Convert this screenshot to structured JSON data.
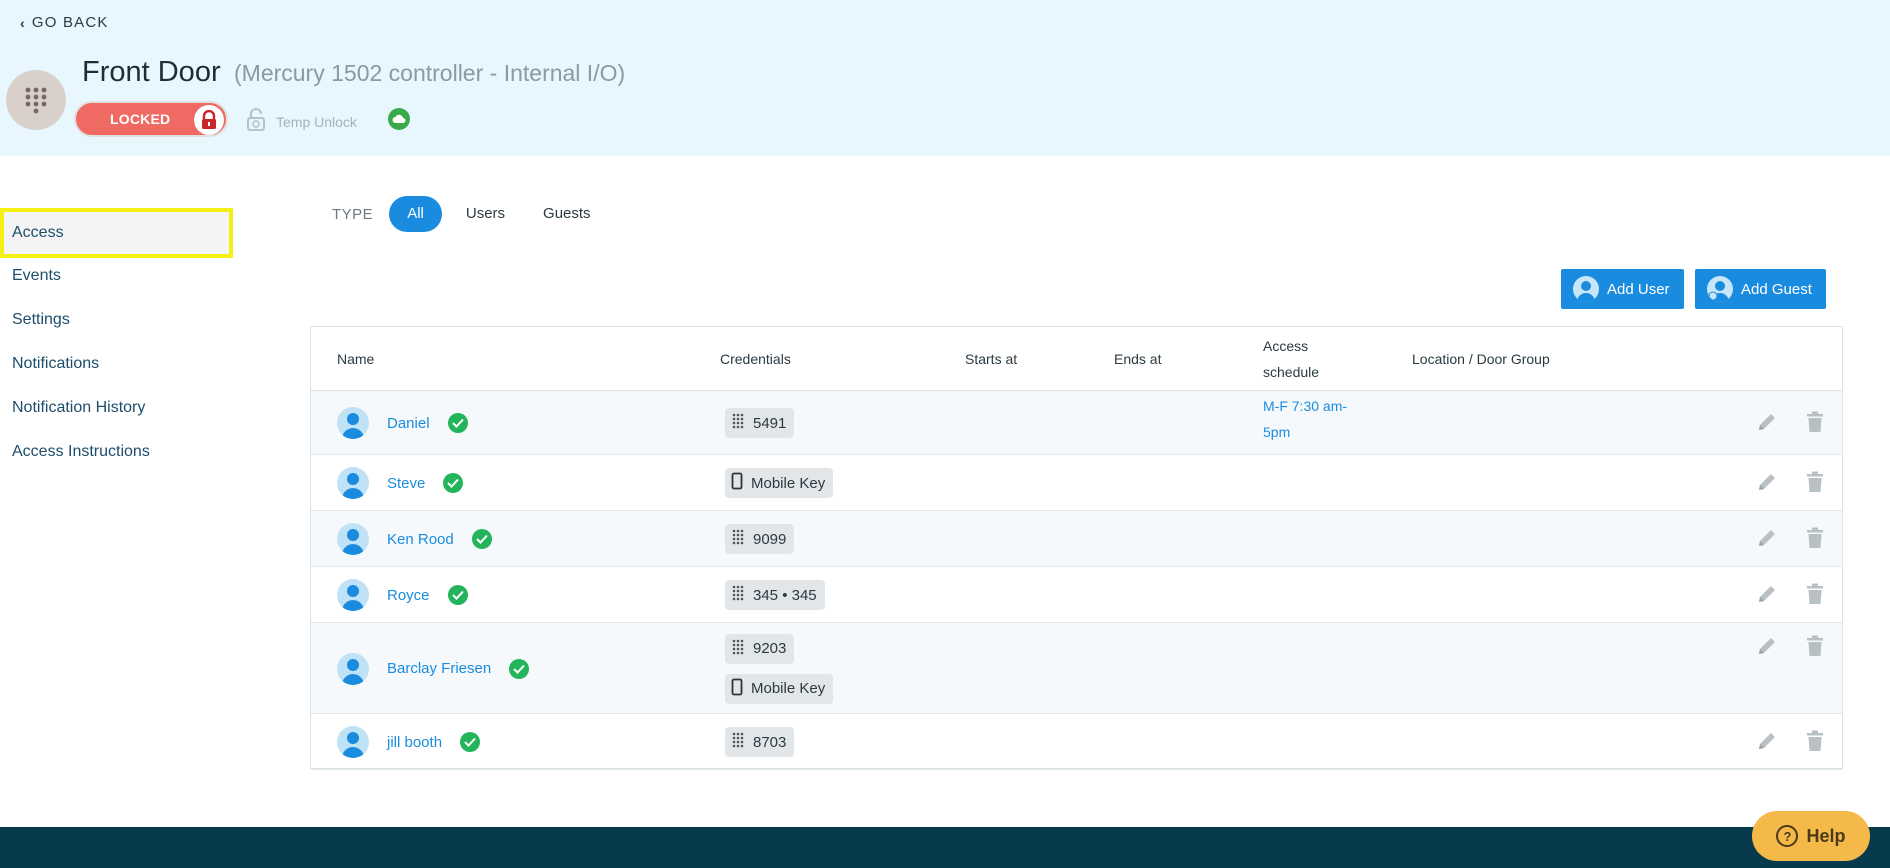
{
  "header": {
    "go_back": "GO BACK",
    "door_name": "Front Door",
    "controller": "(Mercury 1502 controller - Internal I/O)",
    "lock_status": "LOCKED",
    "temp_unlock": "Temp Unlock",
    "door_icon": "keypad-icon",
    "status_icon": "cloud-icon"
  },
  "sidebar": {
    "items": [
      {
        "label": "Access",
        "active": true
      },
      {
        "label": "Events"
      },
      {
        "label": "Settings"
      },
      {
        "label": "Notifications"
      },
      {
        "label": "Notification History"
      },
      {
        "label": "Access Instructions"
      }
    ]
  },
  "filter": {
    "label": "TYPE",
    "options": [
      "All",
      "Users",
      "Guests"
    ],
    "selected": "All"
  },
  "actions": {
    "add_user": "Add User",
    "add_guest": "Add Guest"
  },
  "table": {
    "columns": [
      "Name",
      "Credentials",
      "Starts at",
      "Ends at",
      "Access\nschedule",
      "Location / Door Group"
    ],
    "rows": [
      {
        "name": "Daniel",
        "credentials": [
          {
            "type": "keypad",
            "value": "5491"
          }
        ],
        "starts": "",
        "ends": "",
        "schedule": "M-F 7:30 am-\n5pm"
      },
      {
        "name": "Steve",
        "credentials": [
          {
            "type": "mobile",
            "value": "Mobile Key"
          }
        ],
        "starts": "",
        "ends": "",
        "schedule": ""
      },
      {
        "name": "Ken Rood",
        "credentials": [
          {
            "type": "keypad",
            "value": "9099"
          }
        ],
        "starts": "",
        "ends": "",
        "schedule": ""
      },
      {
        "name": "Royce",
        "credentials": [
          {
            "type": "keypad",
            "value": "345 • 345"
          }
        ],
        "starts": "",
        "ends": "",
        "schedule": ""
      },
      {
        "name": "Barclay Friesen",
        "credentials": [
          {
            "type": "keypad",
            "value": "9203"
          },
          {
            "type": "mobile",
            "value": "Mobile Key"
          }
        ],
        "starts": "",
        "ends": "",
        "schedule": ""
      },
      {
        "name": "jill booth",
        "credentials": [
          {
            "type": "keypad",
            "value": "8703"
          }
        ],
        "starts": "",
        "ends": "",
        "schedule": ""
      }
    ]
  },
  "help": {
    "label": "Help"
  },
  "colors": {
    "accent": "#1a8cdf",
    "locked": "#ef6a62",
    "verified": "#23b45c",
    "header_bg": "#e8f6fd",
    "footer_bg": "#063a4c",
    "help_bg": "#f5b949",
    "highlight": "#f5ef14"
  }
}
